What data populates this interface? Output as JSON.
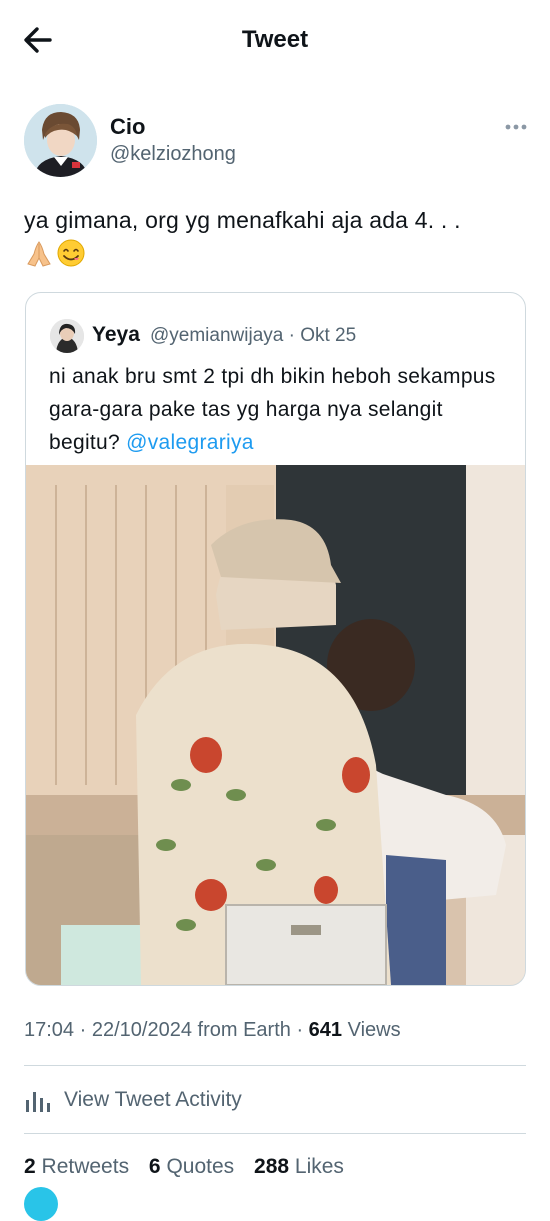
{
  "header": {
    "title": "Tweet",
    "back_icon": "back-arrow-icon"
  },
  "tweet": {
    "author_name": "Cio",
    "author_handle": "@kelziozhong",
    "text": "ya gimana, org yg menafkahi aja ada 4. . .",
    "emojis": [
      "folded-hands-icon",
      "smiling-face-icon"
    ]
  },
  "quoted": {
    "name": "Yeya",
    "handle_date": "@yemianwijaya · Okt 25",
    "text": "ni anak bru smt 2 tpi dh bikin heboh sekampus gara-gara pake tas yg harga nya selangit begitu?",
    "mention": "@valegrariya"
  },
  "meta": {
    "time": "17:04",
    "date": "22/10/2024",
    "source": "from Earth",
    "views_count": "641",
    "views_label": "Views"
  },
  "activity": {
    "label": "View Tweet Activity"
  },
  "stats": [
    {
      "count": "2",
      "label": "Retweets"
    },
    {
      "count": "6",
      "label": "Quotes"
    },
    {
      "count": "288",
      "label": "Likes"
    }
  ],
  "colors": {
    "accent": "#1d9bf0",
    "secondary_text": "#536471",
    "border": "#cfd9de"
  }
}
